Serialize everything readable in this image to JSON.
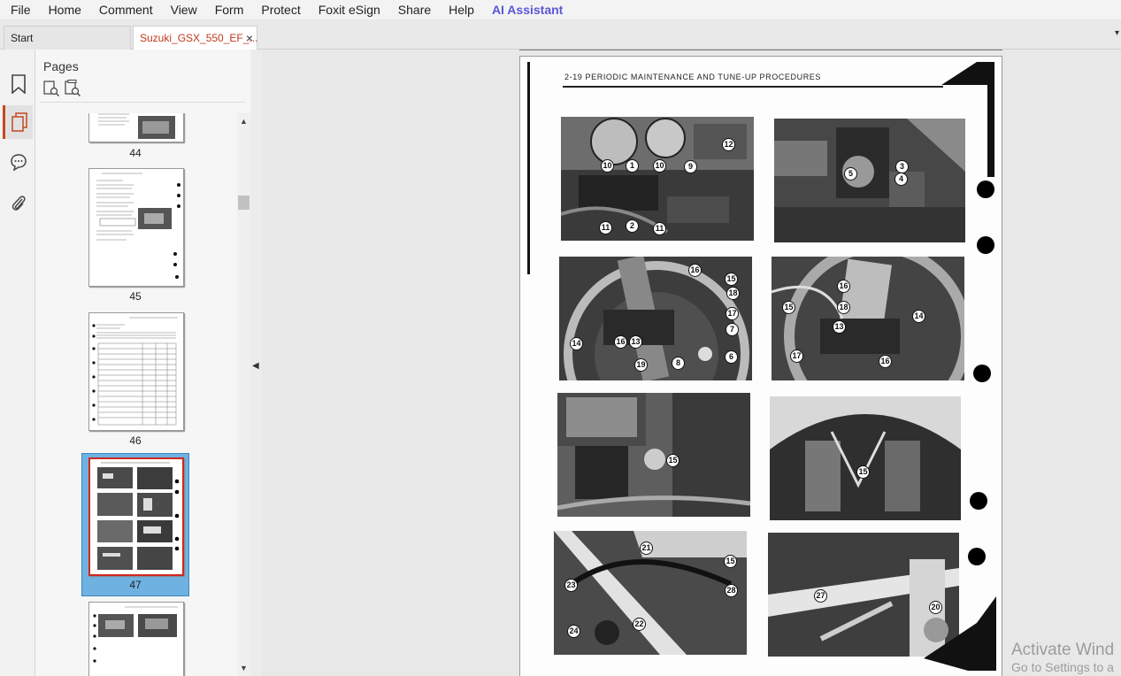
{
  "menu": [
    "File",
    "Home",
    "Comment",
    "View",
    "Form",
    "Protect",
    "Foxit eSign",
    "Share",
    "Help",
    "AI Assistant"
  ],
  "tabs": {
    "start": "Start",
    "document": "Suzuki_GSX_550_EF_...",
    "close": "×",
    "overflow": "▾"
  },
  "rail": {
    "icons": [
      "bookmark-icon",
      "pages-icon",
      "comments-icon",
      "attachment-icon"
    ],
    "active": "pages-icon"
  },
  "panel": {
    "title": "Pages",
    "tools": [
      "zoom-in-thumbnail-icon",
      "zoom-out-thumbnail-icon"
    ]
  },
  "thumbnails": [
    {
      "page": "44"
    },
    {
      "page": "45"
    },
    {
      "page": "46"
    },
    {
      "page": "47",
      "selected": true
    },
    {
      "page": ""
    }
  ],
  "document": {
    "page_header": "2-19   PERIODIC MAINTENANCE AND TUNE-UP PROCEDURES",
    "callouts": [
      "10",
      "1",
      "10",
      "9",
      "12",
      "11",
      "2",
      "11",
      "5",
      "3",
      "4",
      "16",
      "15",
      "18",
      "17",
      "7",
      "14",
      "16",
      "13",
      "19",
      "8",
      "6",
      "16",
      "18",
      "15",
      "13",
      "17",
      "14",
      "16",
      "15",
      "15",
      "21",
      "15",
      "23",
      "28",
      "22",
      "24",
      "27",
      "20"
    ]
  },
  "watermark": {
    "line1": "Activate Wind",
    "line2": "Go to Settings to a"
  },
  "colors": {
    "accent": "#c6461d",
    "ai": "#5a57d6",
    "selection": "#6fb2e2"
  }
}
